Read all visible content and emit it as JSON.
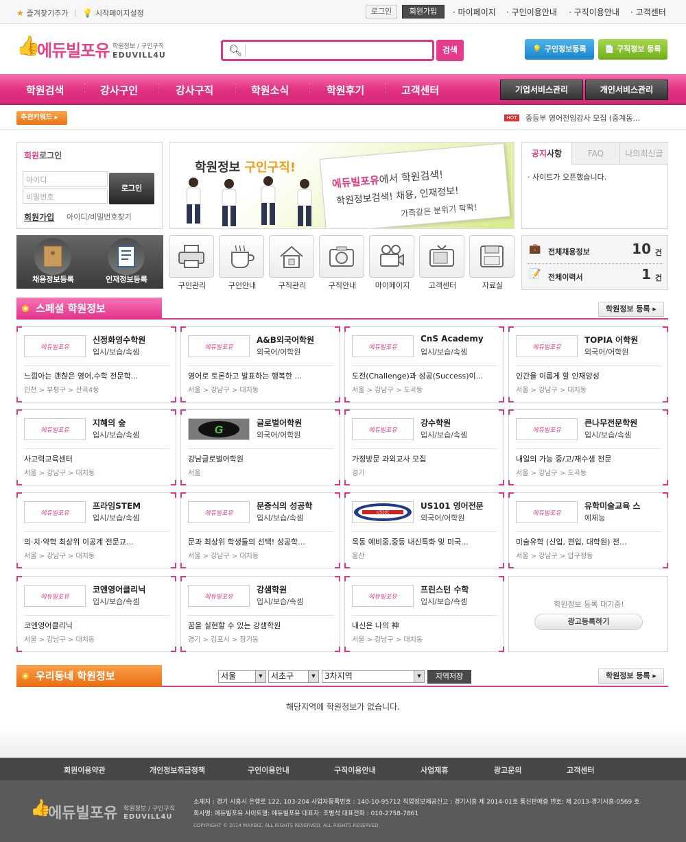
{
  "topbar": {
    "bookmark": "즐겨찾기추가",
    "startpage": "시작페이지설정",
    "login": "로그인",
    "join": "회원가입",
    "links": [
      "마이페이지",
      "구인이용안내",
      "구직이용안내",
      "고객센터"
    ]
  },
  "header": {
    "logo_main": "에듀빌포유",
    "logo_sub": "학원정보 / 구인구직",
    "logo_en": "EDUVILL4U",
    "search_placeholder": "",
    "search_button": "검색",
    "btn_job_register": "구인정보등록",
    "btn_resume_register": "구직정보 등록"
  },
  "nav": {
    "items": [
      "학원검색",
      "강사구인",
      "강사구직",
      "학원소식",
      "학원후기",
      "고객센터"
    ],
    "corp_service": "기업서비스관리",
    "personal_service": "개인서비스관리"
  },
  "keyword_bar": {
    "button": "추천키워드",
    "hot_badge": "HOT",
    "hot_text": "중등부 영어전임강사 모집 (중계동..."
  },
  "login_box": {
    "title_strong": "회원",
    "title_rest": "로그인",
    "id_placeholder": "아이디",
    "pw_placeholder": "비밀번호",
    "login_button": "로그인",
    "join": "회원가입",
    "find": "아이디/비밀번호찾기"
  },
  "banner": {
    "title_a": "학원정보 ",
    "title_b": "구인구직!",
    "line1_brand": "에듀빌포유",
    "line1_rest": "에서 학원검색!",
    "line2": "학원정보검색! 채용, 인재정보!",
    "line3": "가족같은 분위기 팍팍!"
  },
  "notice": {
    "tabs": [
      "공지사항",
      "FAQ",
      "나의최신글"
    ],
    "active_tab_strong": "공지",
    "active_tab_rest": "사항",
    "items": [
      "사이트가 오픈했습니다."
    ]
  },
  "services": {
    "job_post": "채용정보등록",
    "resume_post": "인재정보등록"
  },
  "quick_icons": [
    {
      "label": "구인관리",
      "icon": "printer-icon"
    },
    {
      "label": "구인안내",
      "icon": "coffee-icon"
    },
    {
      "label": "구직관리",
      "icon": "house-icon"
    },
    {
      "label": "구직안내",
      "icon": "camera-icon"
    },
    {
      "label": "마이페이지",
      "icon": "video-icon"
    },
    {
      "label": "고객센터",
      "icon": "tv-icon"
    },
    {
      "label": "자료실",
      "icon": "disk-icon"
    }
  ],
  "counts": {
    "jobs_label": "전체채용정보",
    "jobs_value": "10",
    "resumes_label": "전체이력서",
    "resumes_value": "1",
    "unit": "건"
  },
  "special": {
    "title": "스페셜 학원정보",
    "register_button": "학원정보 등록",
    "cards": [
      {
        "name": "신정화영수학원",
        "cat": "입시/보습/속셈",
        "desc": "느낌아는 괜찮은 영어,수학 전문학...",
        "loc": "인천 > 부평구 > 산곡4동",
        "thumb": "에듀빌포유"
      },
      {
        "name": "A&B외국어학원",
        "cat": "외국어/어학원",
        "desc": "영어로 토론하고 발표하는 행복한 ...",
        "loc": "서울 > 강남구 > 대치동",
        "thumb": "에듀빌포유"
      },
      {
        "name": "CnS Academy",
        "cat": "입시/보습/속셈",
        "desc": "도전(Challenge)과 성공(Success)이...",
        "loc": "서울 > 강남구 > 도곡동",
        "thumb": "에듀빌포유"
      },
      {
        "name": "TOPIA 어학원",
        "cat": "외국어/어학원",
        "desc": "인간을 이롭게 할 인재양성",
        "loc": "서울 > 강남구 > 대치동",
        "thumb": "에듀빌포유"
      },
      {
        "name": "지혜의 숲",
        "cat": "입시/보습/속셈",
        "desc": "사고력교육센터",
        "loc": "서울 > 강남구 > 대치동",
        "thumb": "에듀빌포유"
      },
      {
        "name": "글로벌어학원",
        "cat": "외국어/어학원",
        "desc": "강남글로벌어학원",
        "loc": "서울",
        "thumb": "G"
      },
      {
        "name": "강수학원",
        "cat": "입시/보습/속셈",
        "desc": "가정방문 과외교사 모집",
        "loc": "경기",
        "thumb": "에듀빌포유"
      },
      {
        "name": "큰나무전문학원",
        "cat": "입시/보습/속셈",
        "desc": "내일의 가능 중/고/재수생 전문",
        "loc": "서울 > 강남구 > 도곡동",
        "thumb": "에듀빌포유"
      },
      {
        "name": "프라임STEM",
        "cat": "입시/보습/속셈",
        "desc": "의·치·약학 최상위 이공계 전문교...",
        "loc": "서울 > 강남구 > 대치동",
        "thumb": "에듀빌포유"
      },
      {
        "name": "문중식의 성공학",
        "cat": "입시/보습/속셈",
        "desc": "문과 최상위 학생들의 선택! 성공학...",
        "loc": "서울 > 강남구 > 대치동",
        "thumb": "에듀빌포유"
      },
      {
        "name": "US101 영어전문",
        "cat": "외국어/어학원",
        "desc": "옥동 예비중,중등 내신특화 및 미국...",
        "loc": "울산",
        "thumb": "US101"
      },
      {
        "name": "유학미술교육 스",
        "cat": "예체능",
        "desc": "미술유학 (신입, 편입, 대학원) 전...",
        "loc": "서울 > 강남구 > 압구정동",
        "thumb": "에듀빌포유"
      },
      {
        "name": "코엔영어클리닉",
        "cat": "입시/보습/속셈",
        "desc": "코엔영어클리닉",
        "loc": "서울 > 강남구 > 대치동",
        "thumb": "에듀빌포유"
      },
      {
        "name": "강샘학원",
        "cat": "입시/보습/속셈",
        "desc": "꿈을 실현할 수 있는 강샘학원",
        "loc": "경기 > 김포시 > 장기동",
        "thumb": "에듀빌포유"
      },
      {
        "name": "프린스턴 수학",
        "cat": "입시/보습/속셈",
        "desc": "내신은 나의 神",
        "loc": "서울 > 강남구 > 대치동",
        "thumb": "에듀빌포유"
      }
    ],
    "empty_msg": "학원정보 등록 대기중!",
    "empty_btn": "광고등록하기"
  },
  "local": {
    "title": "우리동네 학원정보",
    "sel1": "서울",
    "sel2": "서초구",
    "sel3": "3차지역",
    "save": "지역저장",
    "register_button": "학원정보 등록",
    "no_data": "해당지역에 학원정보가 없습니다."
  },
  "footer": {
    "links": [
      "회원이용약관",
      "개인정보취급정책",
      "구인이용안내",
      "구직이용안내",
      "사업제휴",
      "광고문의",
      "고객센터"
    ],
    "logo_main": "에듀빌포유",
    "logo_sub": "학원정보 / 구인구직",
    "logo_en": "EDUVILL4U",
    "info1": "소재지 : 경기 시흥시 은행로 122, 103-204    사업자등록번호 : 140-10-95712    직업정보제공신고 : 경기시흥 제 2014-01호    통신판매증 번호: 제 2013-경기시흥-0569 호",
    "info2": "회사명: 에듀빌포유    사이트명: 에듀빌포유    대표자: 조병석    대표전화 : 010-2758-7861",
    "copyright": "COPYRIGHT © 2014 MAXBIZ. ALL RIGHTS RESERVED. ALL RIGHTS RESERVED."
  },
  "colors": {
    "accent": "#e0368a",
    "orange": "#ea7313",
    "dark": "#474747"
  }
}
